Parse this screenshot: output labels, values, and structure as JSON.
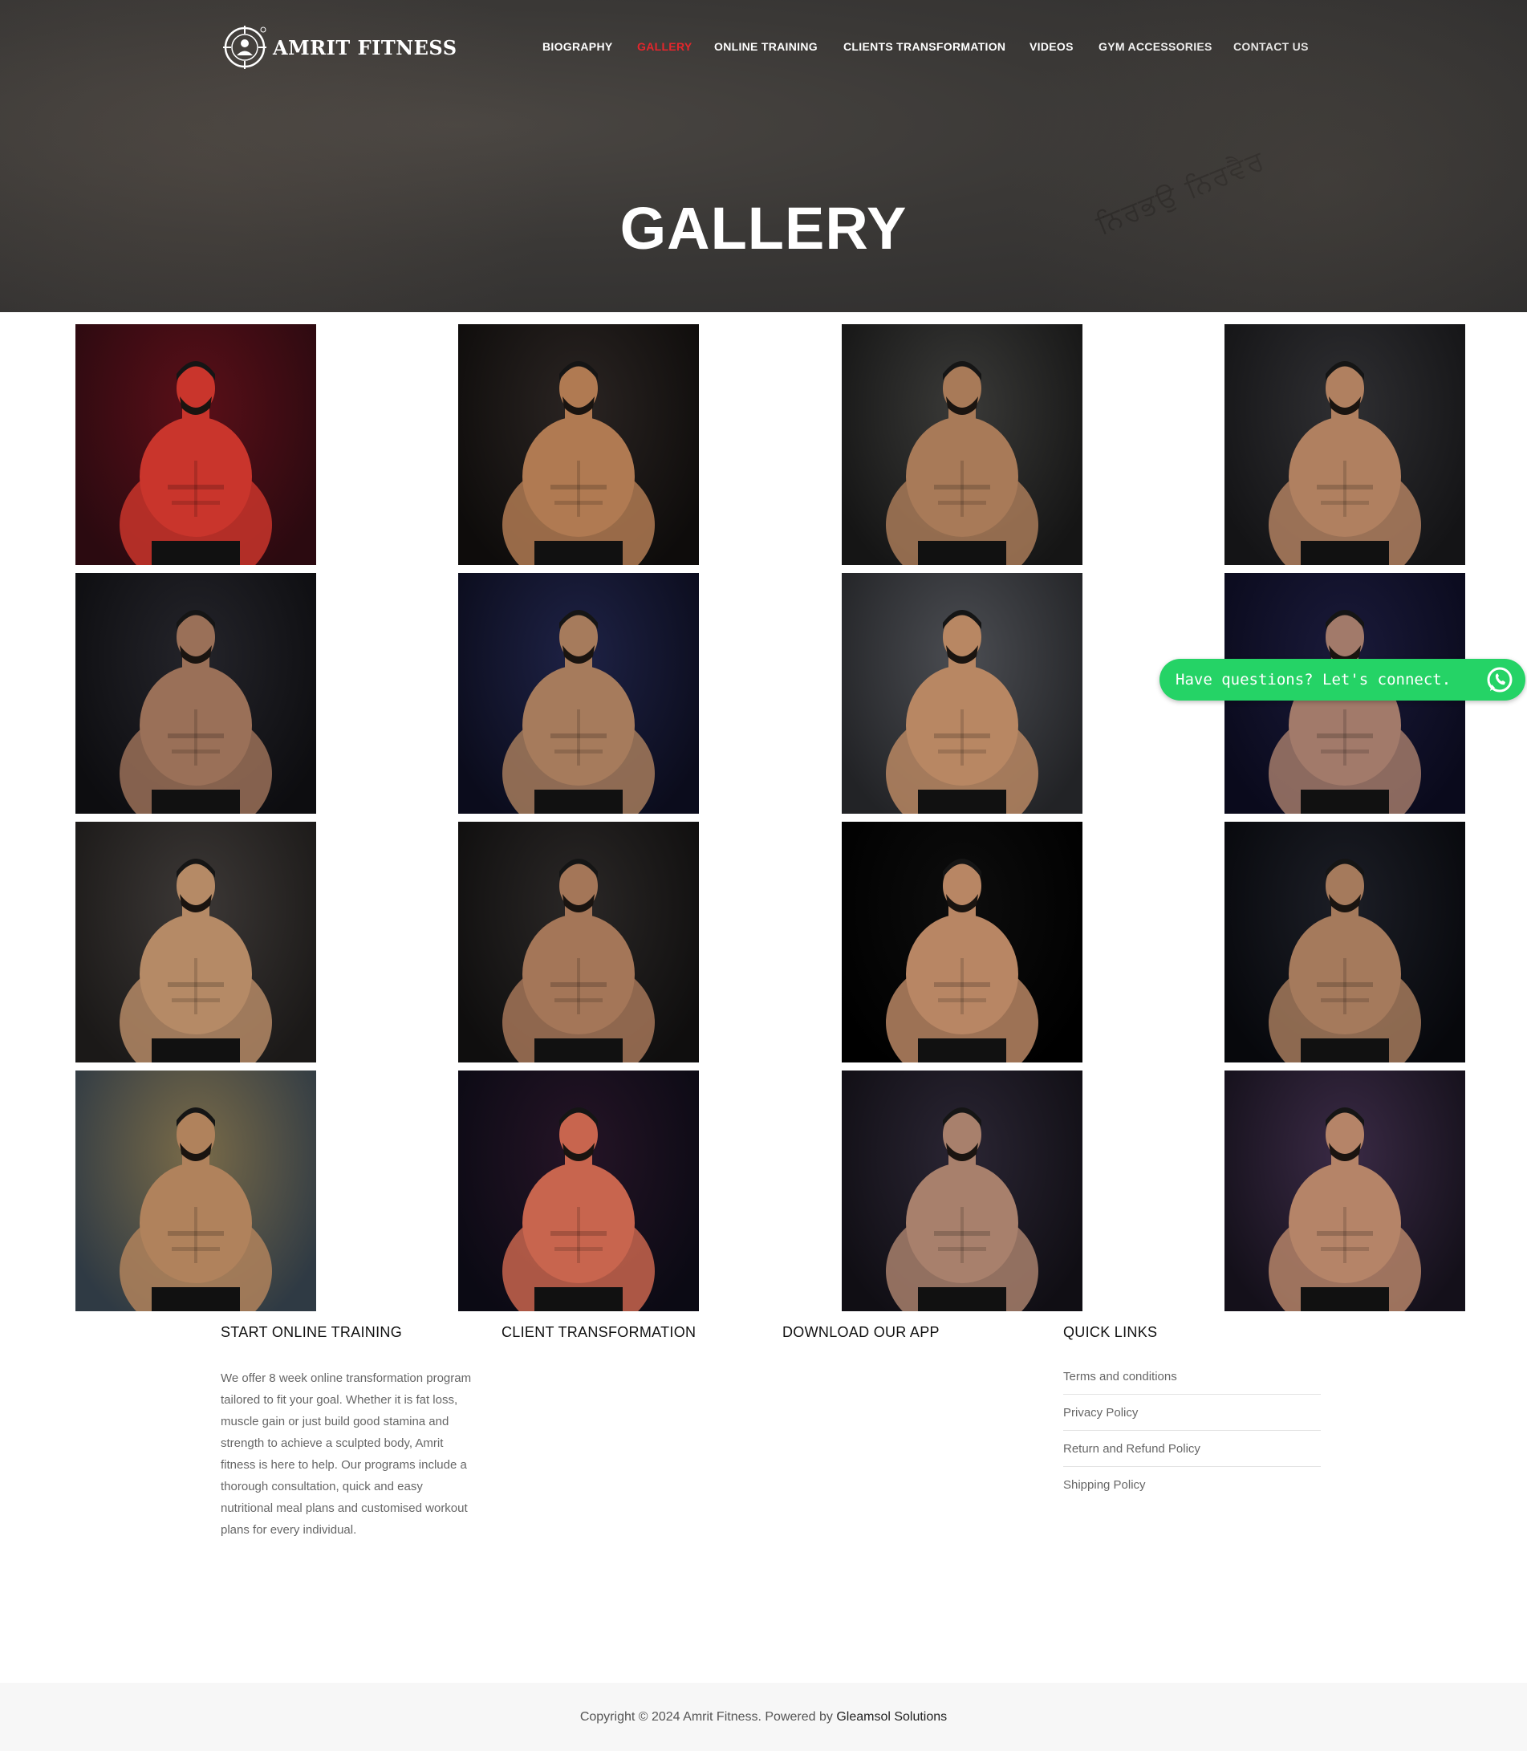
{
  "brand": {
    "name": "AMRIT FITNESS"
  },
  "nav": {
    "items": [
      {
        "label": "BIOGRAPHY",
        "active": false
      },
      {
        "label": "GALLERY",
        "active": true
      },
      {
        "label": "ONLINE TRAINING",
        "active": false
      },
      {
        "label": "CLIENTS TRANSFORMATION",
        "active": false
      },
      {
        "label": "VIDEOS",
        "active": false
      },
      {
        "label": "GYM ACCESSORIES",
        "active": false
      },
      {
        "label": "CONTACT US",
        "active": false
      }
    ],
    "active_color": "#e5262c"
  },
  "page": {
    "title": "GALLERY"
  },
  "gallery": {
    "images": [
      {
        "id": "photo-1",
        "bg": [
          "#5a0f18",
          "#2b0a10"
        ],
        "accent": "#c9352c"
      },
      {
        "id": "photo-2",
        "bg": [
          "#2a2422",
          "#0e0c0b"
        ],
        "accent": "#b07a52"
      },
      {
        "id": "photo-3",
        "bg": [
          "#3a3a38",
          "#151515"
        ],
        "accent": "#a87a58"
      },
      {
        "id": "photo-4",
        "bg": [
          "#2f2f32",
          "#141416"
        ],
        "accent": "#b08060"
      },
      {
        "id": "photo-5",
        "bg": [
          "#24242a",
          "#0d0d10"
        ],
        "accent": "#9a7058"
      },
      {
        "id": "photo-6",
        "bg": [
          "#1e2245",
          "#0b0c1c"
        ],
        "accent": "#a67b5c"
      },
      {
        "id": "photo-7",
        "bg": [
          "#4b4d52",
          "#222326"
        ],
        "accent": "#b88763"
      },
      {
        "id": "photo-8",
        "bg": [
          "#1a1a3a",
          "#0a0a1c"
        ],
        "accent": "#a27a6a"
      },
      {
        "id": "photo-9",
        "bg": [
          "#3c3836",
          "#1b1918"
        ],
        "accent": "#b58a66"
      },
      {
        "id": "photo-10",
        "bg": [
          "#2a2726",
          "#0f0e0e"
        ],
        "accent": "#a47658"
      },
      {
        "id": "photo-11",
        "bg": [
          "#0d0d0d",
          "#000000"
        ],
        "accent": "#b88664"
      },
      {
        "id": "photo-12",
        "bg": [
          "#1c1e26",
          "#07080c"
        ],
        "accent": "#a57a5c"
      },
      {
        "id": "photo-13",
        "bg": [
          "#7a6b48",
          "#2f3a44"
        ],
        "accent": "#b0825c"
      },
      {
        "id": "photo-14",
        "bg": [
          "#251426",
          "#0b0a14"
        ],
        "accent": "#c8654e"
      },
      {
        "id": "photo-15",
        "bg": [
          "#2a2533",
          "#100e14"
        ],
        "accent": "#a8806c"
      },
      {
        "id": "photo-16",
        "bg": [
          "#3a2a45",
          "#14101a"
        ],
        "accent": "#b58468"
      }
    ]
  },
  "whatsapp": {
    "label": "Have questions? Let's connect.",
    "color": "#25d366",
    "icon": "whatsapp-icon"
  },
  "footer": {
    "columns": [
      {
        "heading": "START ONLINE TRAINING"
      },
      {
        "heading": "CLIENT TRANSFORMATION"
      },
      {
        "heading": "DOWNLOAD OUR APP"
      },
      {
        "heading": "QUICK LINKS"
      }
    ],
    "training_text": "We offer 8 week online transformation program tailored to fit your goal. Whether it is fat loss, muscle gain or just build good stamina and strength to achieve a sculpted body, Amrit fitness is here to help. Our programs include a thorough consultation, quick and easy nutritional meal plans and customised workout plans for every individual.",
    "quick_links": [
      {
        "label": "Terms and conditions"
      },
      {
        "label": "Privacy Policy"
      },
      {
        "label": "Return and Refund Policy"
      },
      {
        "label": "Shipping Policy"
      }
    ],
    "copyright_prefix": "Copyright © 2024 Amrit Fitness. Powered by ",
    "powered_by": "Gleamsol Solutions"
  }
}
